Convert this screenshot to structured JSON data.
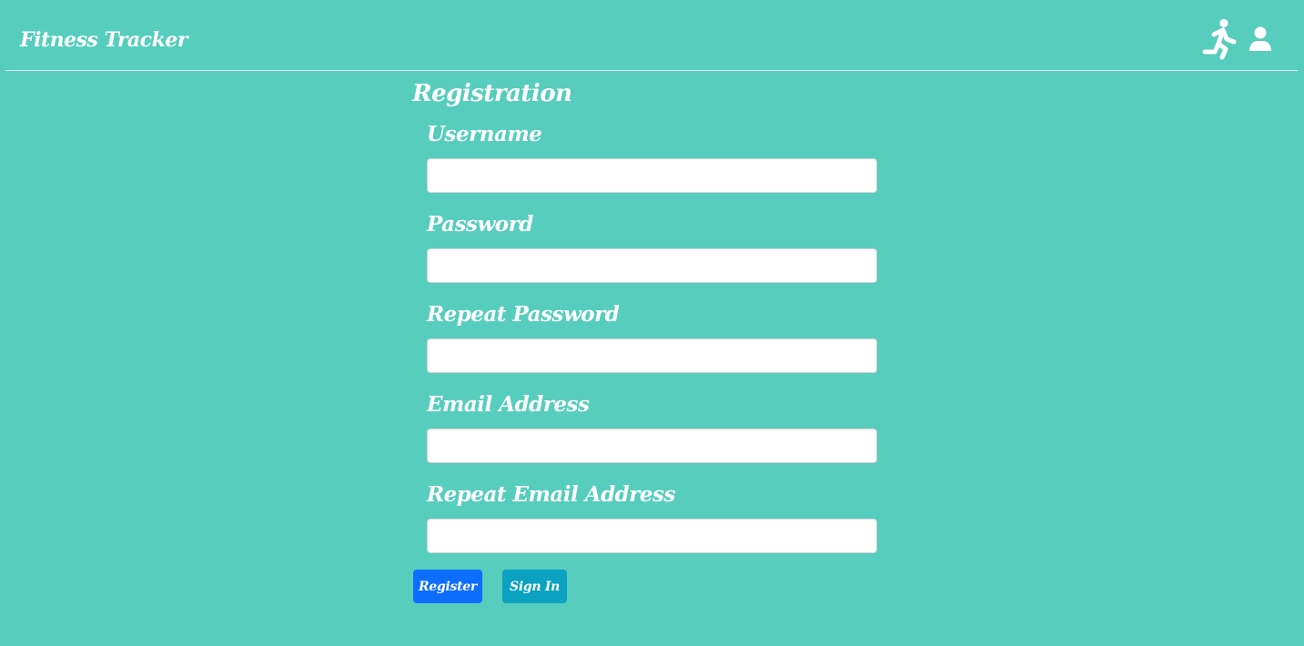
{
  "header": {
    "brand": "Fitness Tracker",
    "icons": [
      "running-icon",
      "user-icon"
    ]
  },
  "form": {
    "title": "Registration",
    "fields": [
      {
        "label": "Username",
        "value": "",
        "type": "text"
      },
      {
        "label": "Password",
        "value": "",
        "type": "password"
      },
      {
        "label": "Repeat Password",
        "value": "",
        "type": "password"
      },
      {
        "label": "Email Address",
        "value": "",
        "type": "email"
      },
      {
        "label": "Repeat Email Address",
        "value": "",
        "type": "email"
      }
    ],
    "register_label": "Register",
    "signin_label": "Sign In"
  },
  "colors": {
    "background": "#57cdbd",
    "register_button": "#0d6efd",
    "signin_button": "#0aa2c0",
    "text": "#ffffff"
  }
}
